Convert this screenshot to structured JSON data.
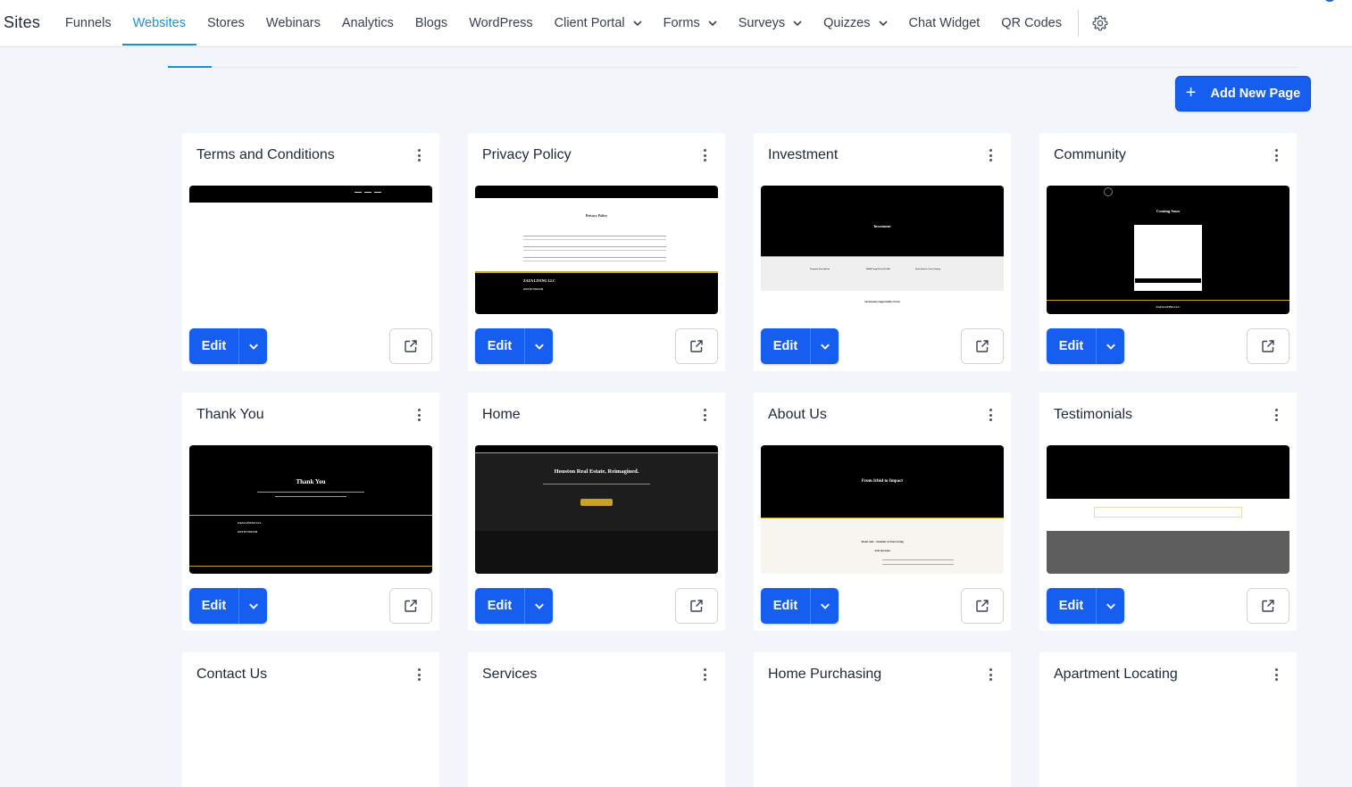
{
  "app": {
    "title": "Sites"
  },
  "nav": {
    "items": [
      {
        "label": "Funnels",
        "dropdown": false
      },
      {
        "label": "Websites",
        "dropdown": false,
        "active": true
      },
      {
        "label": "Stores",
        "dropdown": false
      },
      {
        "label": "Webinars",
        "dropdown": false
      },
      {
        "label": "Analytics",
        "dropdown": false
      },
      {
        "label": "Blogs",
        "dropdown": false
      },
      {
        "label": "WordPress",
        "dropdown": false
      },
      {
        "label": "Client Portal",
        "dropdown": true
      },
      {
        "label": "Forms",
        "dropdown": true
      },
      {
        "label": "Surveys",
        "dropdown": true
      },
      {
        "label": "Quizzes",
        "dropdown": true
      },
      {
        "label": "Chat Widget",
        "dropdown": false
      },
      {
        "label": "QR Codes",
        "dropdown": false
      }
    ],
    "settings_icon": "gear-icon"
  },
  "actions": {
    "add_new_page": "Add New Page"
  },
  "pages": [
    {
      "title": "Terms and Conditions"
    },
    {
      "title": "Privacy Policy",
      "heading": "Privacy Policy",
      "footer": "ZAZA LIVING LLC",
      "footer_sub": "GET IN TOUCH"
    },
    {
      "title": "Investment",
      "heading": "Investment",
      "cols": [
        "Property Investment",
        "Build Long-Term Wealth",
        "Start Smart, Grow Strong"
      ],
      "sub": "Investment Opportunity Form"
    },
    {
      "title": "Community",
      "heading": "Coming Soon",
      "footer": "ZAZA LIVING LLC"
    },
    {
      "title": "Thank You",
      "heading": "Thank You",
      "footer": "ZAZA LIVING LLC",
      "footer_sub": "GET IN TOUCH"
    },
    {
      "title": "Home",
      "heading": "Houston Real Estate, Reimagined."
    },
    {
      "title": "About Us",
      "heading": "From Irbid to Impact",
      "sub": "About Aziz – Founder of Zaza Living",
      "sub2": "Aziz Qwasme"
    },
    {
      "title": "Testimonials"
    },
    {
      "title": "Contact Us"
    },
    {
      "title": "Services"
    },
    {
      "title": "Home Purchasing"
    },
    {
      "title": "Apartment Locating"
    }
  ],
  "card_labels": {
    "edit": "Edit"
  },
  "colors": {
    "primary": "#155eef",
    "active_tab": "#1d8fd1",
    "gold": "#c9a227"
  }
}
